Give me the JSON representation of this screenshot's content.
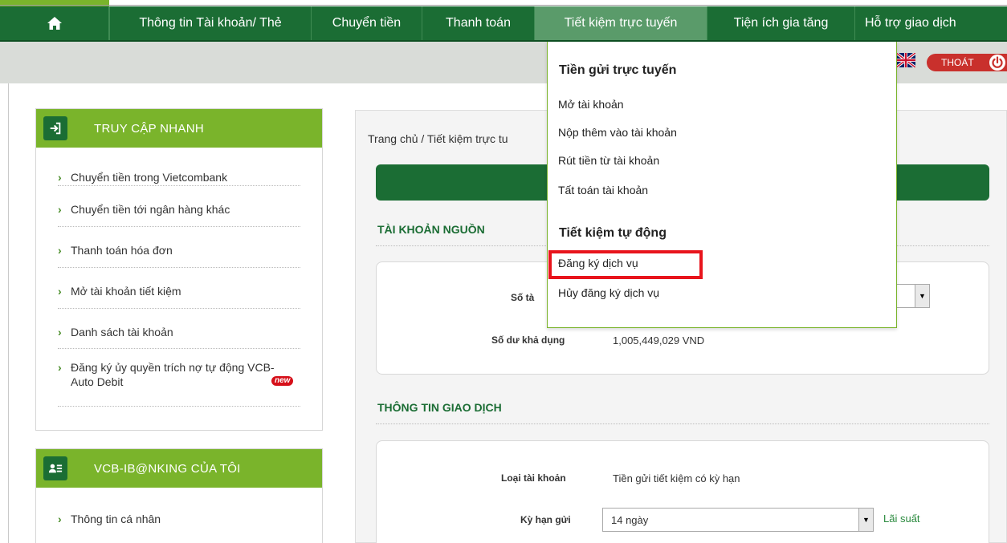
{
  "navbar": {
    "items": [
      {
        "label": "Thông tin Tài khoản/ Thẻ"
      },
      {
        "label": "Chuyển tiền"
      },
      {
        "label": "Thanh toán"
      },
      {
        "label": "Tiết kiệm trực tuyến"
      },
      {
        "label": "Tiện ích gia tăng"
      },
      {
        "label": "Hỗ trợ giao dịch"
      }
    ],
    "home_icon": "home-icon"
  },
  "header": {
    "logout_label": "THOÁT",
    "flag_icon": "uk-flag-icon"
  },
  "quick_access": {
    "title": "TRUY CẬP NHANH",
    "items": [
      {
        "label": "Chuyển tiền trong Vietcombank"
      },
      {
        "label": "Chuyển tiền tới ngân hàng khác"
      },
      {
        "label": "Thanh toán hóa đơn"
      },
      {
        "label": "Mở tài khoản tiết kiệm"
      },
      {
        "label": "Danh sách tài khoản"
      },
      {
        "label": "Đăng ký ủy quyền trích nợ tự động VCB-Auto Debit",
        "badge": "new"
      }
    ]
  },
  "my_ibanking": {
    "title": "VCB-IB@NKING CỦA TÔI",
    "items": [
      {
        "label": "Thông tin cá nhân"
      }
    ]
  },
  "main": {
    "breadcrumb": "Trang chủ / Tiết kiệm trực tu",
    "source_account": {
      "title": "TÀI KHOẢN NGUỒN",
      "account_label_partial": "Số tà",
      "balance_label": "Số dư khả dụng",
      "balance_value": "1,005,449,029 VND"
    },
    "transaction": {
      "title": "THÔNG TIN GIAO DỊCH",
      "account_type_label": "Loại tài khoản",
      "account_type_value": "Tiền gửi tiết kiệm có kỳ hạn",
      "term_label": "Kỳ hạn gửi",
      "term_value": "14 ngày",
      "interest_link": "Lãi suất"
    }
  },
  "dropdown": {
    "online_deposit": {
      "title": "Tiền gửi trực tuyến",
      "items": [
        {
          "label": "Mở tài khoản"
        },
        {
          "label": "Nộp thêm vào tài khoản"
        },
        {
          "label": "Rút tiền từ tài khoản"
        },
        {
          "label": "Tất toán tài khoản"
        }
      ]
    },
    "auto_saving": {
      "title": "Tiết kiệm tự động",
      "items": [
        {
          "label": "Đăng ký dịch vụ",
          "highlighted": true
        },
        {
          "label": "Hủy đăng ký dịch vụ"
        }
      ]
    }
  },
  "colors": {
    "brand_green": "#1b6d34",
    "accent_green": "#7ab42b",
    "highlight_red": "#e8141c",
    "logout_red": "#c9302c"
  }
}
